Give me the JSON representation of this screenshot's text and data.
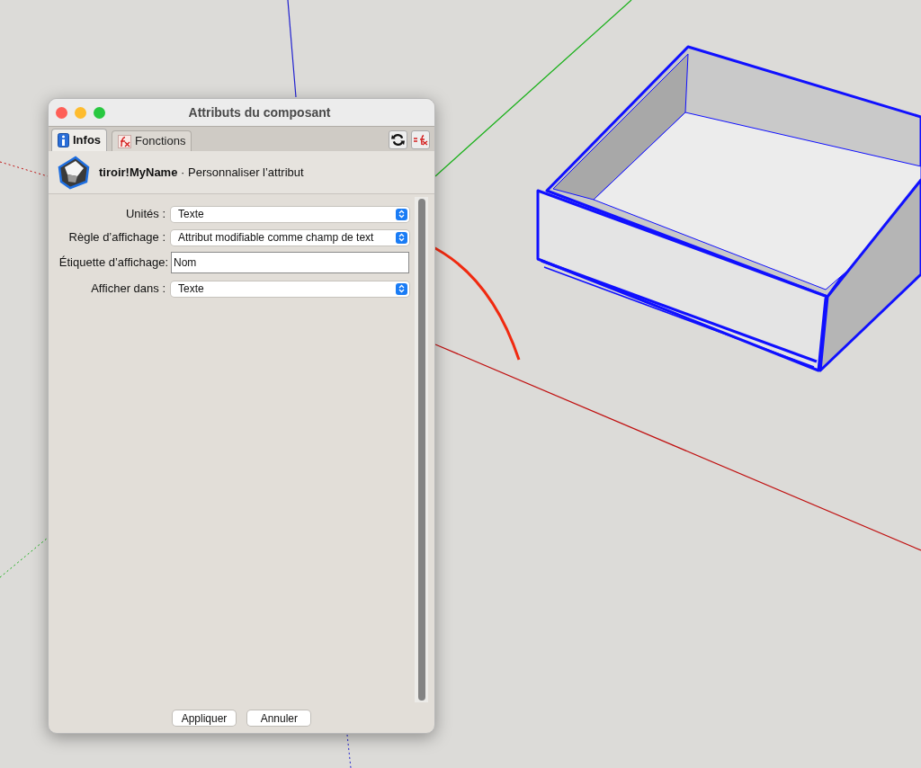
{
  "window": {
    "title": "Attributs du composant"
  },
  "tabs": [
    {
      "label": "Infos",
      "selected": true
    },
    {
      "label": "Fonctions",
      "selected": false
    }
  ],
  "header": {
    "name": "tiroir!MyName",
    "subtitle": "· Personnaliser l’attribut"
  },
  "fields": [
    {
      "kind": "select",
      "label": "Unités :",
      "value": "Texte"
    },
    {
      "kind": "select",
      "label": "Règle d’affichage :",
      "value": "Attribut modifiable comme champ de text"
    },
    {
      "kind": "text",
      "label": "Étiquette d’affichage:",
      "value": "Nom"
    },
    {
      "kind": "select",
      "label": "Afficher dans :",
      "value": "Texte"
    }
  ],
  "buttons": [
    "Appliquer",
    "Annuler"
  ]
}
